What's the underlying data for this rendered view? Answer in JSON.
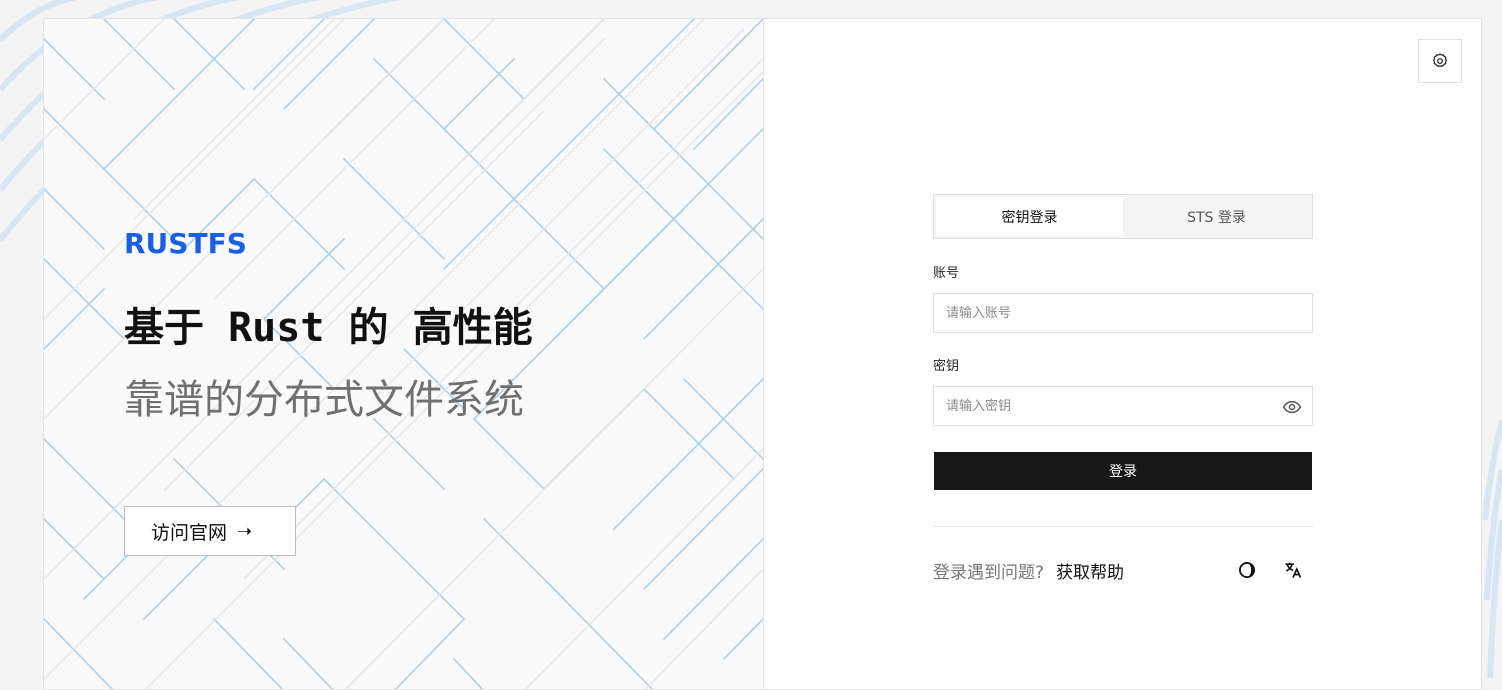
{
  "brand": {
    "logo_text": "RUSTFS",
    "headline": "基于 Rust 的 高性能",
    "subline": "靠谱的分布式文件系统",
    "visit_label": "访问官网",
    "accent": "#1a5fe6"
  },
  "login": {
    "tabs": [
      {
        "label": "密钥登录",
        "active": true
      },
      {
        "label": "STS 登录",
        "active": false
      }
    ],
    "account_label": "账号",
    "account_placeholder": "请输入账号",
    "secret_label": "密钥",
    "secret_placeholder": "请输入密钥",
    "submit_label": "登录",
    "help_text": "登录遇到问题?",
    "help_link": "获取帮助"
  },
  "icons": {
    "settings": "gear-icon",
    "visibility": "eye-icon",
    "theme": "theme-toggle-icon",
    "language": "translate-icon",
    "visit_arrow": "arrow-right-icon"
  }
}
